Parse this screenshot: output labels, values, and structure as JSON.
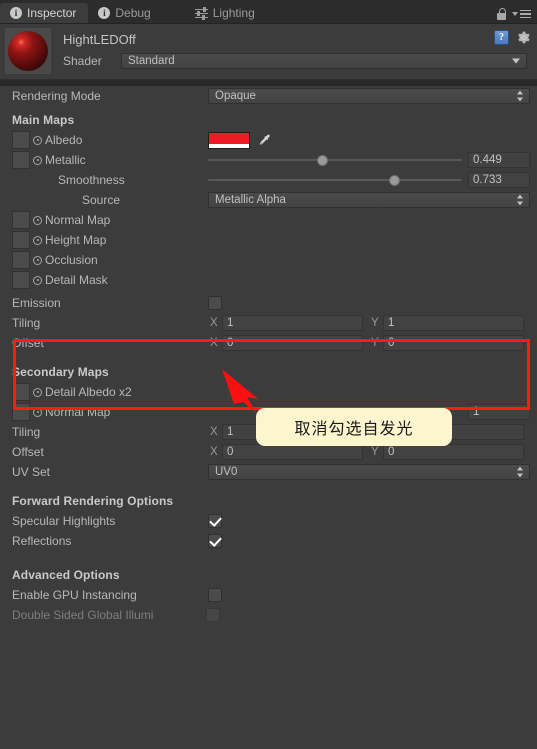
{
  "window": {
    "tabs": [
      {
        "label": "Inspector",
        "icon": "info-icon",
        "active": true
      },
      {
        "label": "Debug",
        "icon": "info-icon",
        "active": false
      },
      {
        "label": "Lighting",
        "icon": "lighting-sliders-icon",
        "active": false
      }
    ],
    "lock_icon": "lock-icon",
    "menu_icon": "hamburger-menu-icon"
  },
  "material": {
    "name": "HightLEDOff",
    "shader_label": "Shader",
    "shader_value": "Standard",
    "help_icon": "help-icon",
    "gear_icon": "gear-icon",
    "preview_icon": "material-sphere-preview"
  },
  "rendering": {
    "label": "Rendering Mode",
    "value": "Opaque"
  },
  "main_maps": {
    "title": "Main Maps",
    "albedo": {
      "label": "Albedo",
      "color": "#ed1c24",
      "alpha_color": "#ffffff",
      "eyedropper_icon": "eyedropper-icon"
    },
    "metallic": {
      "label": "Metallic",
      "value": "0.449",
      "fraction": 0.449
    },
    "smoothness": {
      "label": "Smoothness",
      "value": "0.733",
      "fraction": 0.733
    },
    "source": {
      "label": "Source",
      "value": "Metallic Alpha"
    },
    "normal_map": {
      "label": "Normal Map"
    },
    "height_map": {
      "label": "Height Map"
    },
    "occlusion": {
      "label": "Occlusion"
    },
    "detail_mask": {
      "label": "Detail Mask"
    },
    "emission": {
      "label": "Emission",
      "checked": false
    },
    "tiling": {
      "label": "Tiling",
      "x_axis": "X",
      "x": "1",
      "y_axis": "Y",
      "y": "1"
    },
    "offset": {
      "label": "Offset",
      "x_axis": "X",
      "x": "0",
      "y_axis": "Y",
      "y": "0"
    }
  },
  "secondary_maps": {
    "title": "Secondary Maps",
    "detail_albedo": {
      "label": "Detail Albedo x2"
    },
    "normal_map": {
      "label": "Normal Map",
      "value": "1"
    },
    "tiling": {
      "label": "Tiling",
      "x_axis": "X",
      "x": "1",
      "y_axis": "Y",
      "y": "1"
    },
    "offset": {
      "label": "Offset",
      "x_axis": "X",
      "x": "0",
      "y_axis": "Y",
      "y": "0"
    },
    "uv_set": {
      "label": "UV Set",
      "value": "UV0"
    }
  },
  "forward_rendering": {
    "title": "Forward Rendering Options",
    "specular_highlights": {
      "label": "Specular Highlights",
      "checked": true
    },
    "reflections": {
      "label": "Reflections",
      "checked": true
    }
  },
  "advanced": {
    "title": "Advanced Options",
    "gpu_instancing": {
      "label": "Enable GPU Instancing",
      "checked": false
    },
    "double_sided_gi": {
      "label": "Double Sided Global Illumi",
      "checked": false,
      "disabled": true
    }
  },
  "annotation": {
    "tooltip_text": "取消勾选自发光",
    "highlight_color": "#ff1a1a",
    "tooltip_bg": "#fcf5ce",
    "arrow_icon": "red-pointer-arrow"
  }
}
